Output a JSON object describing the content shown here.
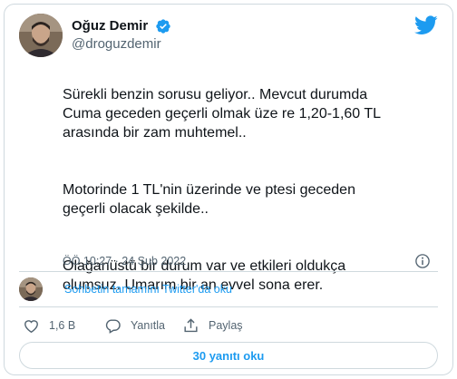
{
  "author": {
    "display_name": "Oğuz Demir",
    "handle": "@droguzdemir"
  },
  "tweet": {
    "paragraphs": [
      "Sürekli benzin sorusu geliyor.. Mevcut durumda\nCuma geceden geçerli olmak üze re 1,20-1,60 TL\narasında bir zam muhtemel..",
      "Motorinde 1 TL'nin üzerinde ve ptesi geceden\ngeçerli olacak şekilde..",
      "Olağanüstü bir durum var ve etkileri oldukça\nolumsuz. Umarım bir an evvel sona erer."
    ],
    "timestamp": "ÖÖ 10:27 · 24 Şub 2022"
  },
  "thread": {
    "link_label": "Sohbetin tamamını Twitter'da oku"
  },
  "actions": {
    "like_count": "1,6 B",
    "reply_label": "Yanıtla",
    "share_label": "Paylaş"
  },
  "replies_button": {
    "label": "30 yanıtı oku"
  },
  "colors": {
    "accent": "#1d9bf0",
    "text": "#0f1419",
    "muted": "#536471",
    "border": "#cfd9de"
  },
  "icons": [
    "verified-badge-icon",
    "twitter-bird-icon",
    "info-icon",
    "heart-icon",
    "reply-icon",
    "share-icon"
  ]
}
